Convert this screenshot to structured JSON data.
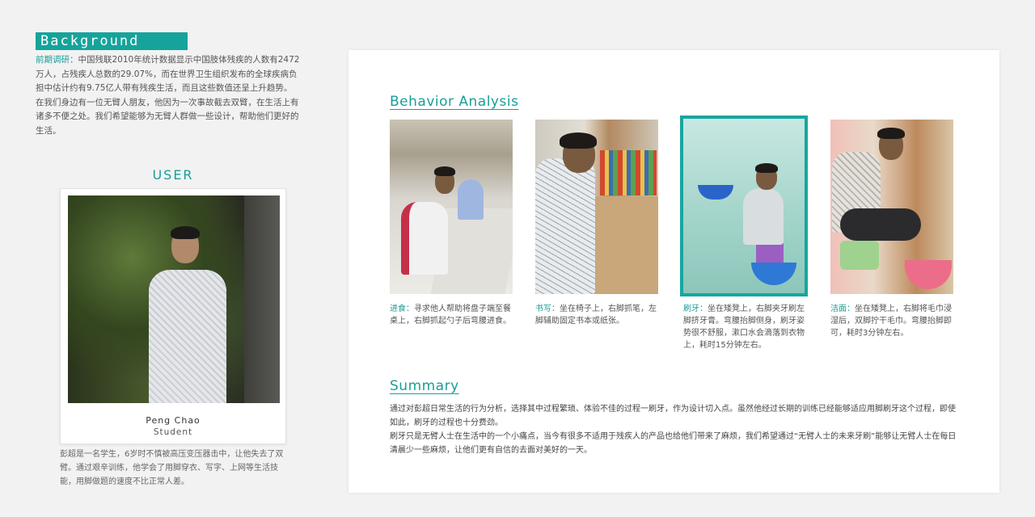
{
  "background": {
    "title": "Background",
    "label": "前期调研：",
    "para1": "中国残联2010年统计数据显示中国肢体残疾的人数有2472万人，占残疾人总数的29.07%，而在世界卫生组织发布的全球疾病负担中估计约有9.75亿人带有残疾生活，而且这些数值还呈上升趋势。",
    "para2": "在我们身边有一位无臂人朋友，他因为一次事故截去双臂，在生活上有诸多不便之处。我们希望能够为无臂人群做一些设计，帮助他们更好的生活。"
  },
  "user": {
    "title": "USER",
    "name": "Peng Chao",
    "role": "Student",
    "description": "彭超是一名学生，6岁时不慎被高压变压器击中，让他失去了双臂。通过艰辛训练，他学会了用脚穿衣、写字、上网等生活技能，用脚做题的速度不比正常人差。"
  },
  "behavior": {
    "title": "Behavior Analysis",
    "items": [
      {
        "label": "进食：",
        "text": "寻求他人帮助将盘子端至餐桌上，右脚抓起勺子后弯腰进食。"
      },
      {
        "label": "书写：",
        "text": "坐在椅子上，右脚抓笔，左脚辅助固定书本或纸张。"
      },
      {
        "label": "刷牙：",
        "text": "坐在矮凳上，右脚夹牙刷左脚挤牙膏。弯腰抬脚侧身，刷牙姿势很不舒服，漱口水会滴落到衣物上，耗时15分钟左右。"
      },
      {
        "label": "洁面：",
        "text": "坐在矮凳上，右脚将毛巾浸湿后，双脚拧干毛巾。弯腰抬脚即可，耗时3分钟左右。"
      }
    ],
    "selected_index": 2
  },
  "summary": {
    "title": "Summary",
    "para1": "通过对彭超日常生活的行为分析，选择其中过程繁琐、体验不佳的过程一刷牙，作为设计切入点。虽然他经过长期的训练已经能够适应用脚刷牙这个过程，即使如此，刷牙的过程也十分费劲。",
    "para2": "刷牙只是无臂人士在生活中的一个小痛点，当今有很多不适用于残疾人的产品也给他们带来了麻烦，我们希望通过“无臂人士的未来牙刷”能够让无臂人士在每日清晨少一些麻烦，让他们更有自信的去面对美好的一天。"
  },
  "colors": {
    "accent": "#1a9e98",
    "header_bg": "#16a39c",
    "page_bg": "#f2f2f2",
    "panel_bg": "#ffffff"
  }
}
